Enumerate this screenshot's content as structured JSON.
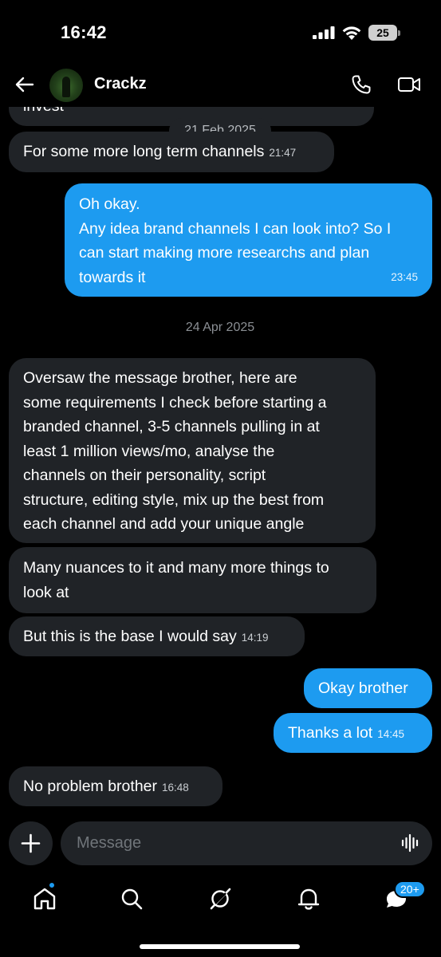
{
  "status_bar": {
    "time": "16:42",
    "battery": "25"
  },
  "header": {
    "contact_name": "Crackz",
    "back_icon": "arrow-left-icon",
    "call_icon": "phone-icon",
    "video_icon": "video-camera-icon"
  },
  "messages": {
    "partial_top": "invest",
    "date_1": "21 Feb 2025",
    "msg_1": {
      "text": "For some more long term channels",
      "time": "21:47"
    },
    "msg_2": {
      "lines": [
        "Oh okay.",
        "Any idea brand channels I can look into? So I",
        "can start making more researchs and plan",
        "towards it"
      ],
      "time": "23:45"
    },
    "date_2": "24 Apr 2025",
    "msg_3": {
      "lines": [
        "Oversaw the message brother, here are",
        "some requirements I check before starting a",
        "branded channel, 3-5 channels pulling in at",
        "least 1 million views/mo, analyse the",
        "channels on their personality, script",
        "structure, editing style, mix up the best from",
        "each channel and add your unique angle"
      ]
    },
    "msg_4": {
      "lines": [
        "Many nuances to it and many more things to",
        "look at"
      ]
    },
    "msg_5": {
      "text": "But this is the base I would say",
      "time": "14:19"
    },
    "msg_6": {
      "text": "Okay brother"
    },
    "msg_7": {
      "text": "Thanks a lot",
      "time": "14:45"
    },
    "msg_8": {
      "text": "No problem brother",
      "time": "16:48"
    }
  },
  "composer": {
    "placeholder": "Message",
    "add_icon": "plus-icon",
    "voice_icon": "voice-wave-icon"
  },
  "nav": {
    "items": [
      "home-icon",
      "search-icon",
      "grok-icon",
      "bell-icon",
      "messages-icon"
    ],
    "messages_badge": "20+"
  },
  "colors": {
    "outgoing_bubble": "#1d9bf0",
    "incoming_bubble": "#202327",
    "background": "#000000"
  }
}
